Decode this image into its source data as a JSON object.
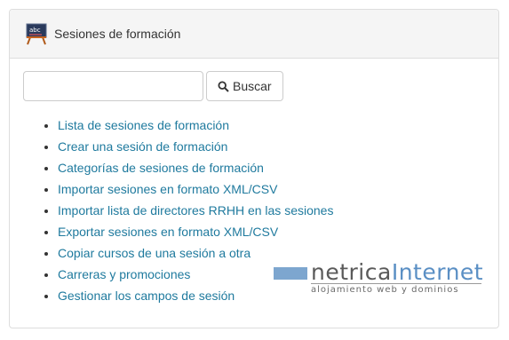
{
  "panel": {
    "title": "Sesiones de formación",
    "title_icon": "blackboard-icon"
  },
  "search": {
    "value": "",
    "placeholder": "",
    "button_label": "Buscar",
    "button_icon": "search-icon"
  },
  "links": [
    {
      "label": "Lista de sesiones de formación"
    },
    {
      "label": "Crear una sesión de formación"
    },
    {
      "label": "Categorías de sesiones de formación"
    },
    {
      "label": "Importar sesiones en formato XML/CSV"
    },
    {
      "label": "Importar lista de directores RRHH en las sesiones"
    },
    {
      "label": "Exportar sesiones en formato XML/CSV"
    },
    {
      "label": "Copiar cursos de una sesión a otra"
    },
    {
      "label": "Carreras y promociones"
    },
    {
      "label": "Gestionar los campos de sesión"
    }
  ],
  "watermark": {
    "brand_left": "netrica",
    "brand_right": "Internet",
    "tagline": "alojamiento web y dominios"
  },
  "colors": {
    "link": "#1f7a9e",
    "heading_bg": "#f5f5f5",
    "border": "#dddddd",
    "watermark_accent": "#5a8fc4"
  }
}
